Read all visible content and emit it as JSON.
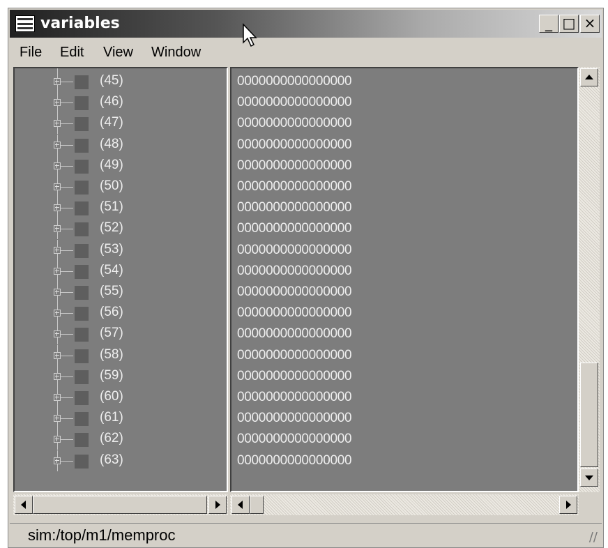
{
  "window": {
    "title": "variables",
    "icon": "app-window-icon",
    "controls": {
      "minimize": "_",
      "maximize": "□",
      "close": "×"
    }
  },
  "menu": [
    "File",
    "Edit",
    "View",
    "Window"
  ],
  "tree_rows": [
    {
      "index": "(45)",
      "value": "0000000000000000"
    },
    {
      "index": "(46)",
      "value": "0000000000000000"
    },
    {
      "index": "(47)",
      "value": "0000000000000000"
    },
    {
      "index": "(48)",
      "value": "0000000000000000"
    },
    {
      "index": "(49)",
      "value": "0000000000000000"
    },
    {
      "index": "(50)",
      "value": "0000000000000000"
    },
    {
      "index": "(51)",
      "value": "0000000000000000"
    },
    {
      "index": "(52)",
      "value": "0000000000000000"
    },
    {
      "index": "(53)",
      "value": "0000000000000000"
    },
    {
      "index": "(54)",
      "value": "0000000000000000"
    },
    {
      "index": "(55)",
      "value": "0000000000000000"
    },
    {
      "index": "(56)",
      "value": "0000000000000000"
    },
    {
      "index": "(57)",
      "value": "0000000000000000"
    },
    {
      "index": "(58)",
      "value": "0000000000000000"
    },
    {
      "index": "(59)",
      "value": "0000000000000000"
    },
    {
      "index": "(60)",
      "value": "0000000000000000"
    },
    {
      "index": "(61)",
      "value": "0000000000000000"
    },
    {
      "index": "(62)",
      "value": "0000000000000000"
    },
    {
      "index": "(63)",
      "value": "0000000000000000"
    }
  ],
  "status": {
    "path": "sim:/top/m1/memproc"
  },
  "colors": {
    "pane_bg": "#7d7d7d",
    "chrome": "#d4d0c8"
  }
}
